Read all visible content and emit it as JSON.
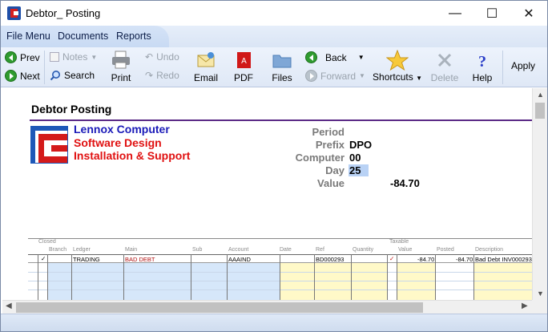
{
  "window": {
    "title": "Debtor_ Posting",
    "minimize": "—",
    "maximize": "☐",
    "close": "✕"
  },
  "menu": [
    "File Menu",
    "Documents",
    "Reports"
  ],
  "toolbar": {
    "prev": "Prev",
    "next": "Next",
    "notes": "Notes",
    "search": "Search",
    "print": "Print",
    "undo": "Undo",
    "redo": "Redo",
    "email": "Email",
    "pdf": "PDF",
    "files": "Files",
    "back": "Back",
    "forward": "Forward",
    "shortcuts": "Shortcuts",
    "delete": "Delete",
    "help": "Help",
    "apply": "Apply"
  },
  "form": {
    "heading": "Debtor Posting",
    "company": [
      "Lennox Computer",
      "Software Design",
      "Installation & Support"
    ],
    "fields": [
      {
        "label": "Period",
        "value": ""
      },
      {
        "label": "Prefix",
        "value": "DPO"
      },
      {
        "label": "Computer",
        "value": "00"
      },
      {
        "label": "Day",
        "value": "25"
      },
      {
        "label": "Value",
        "value": "-84.70"
      }
    ]
  },
  "grid": {
    "group_headers": {
      "closed": "Closed",
      "taxable": "Taxable"
    },
    "columns": [
      "Branch",
      "Ledger",
      "Main",
      "Sub",
      "Account",
      "Date",
      "Ref",
      "Quantity",
      "Value",
      "Posted",
      "Description"
    ],
    "rows": [
      {
        "closed": "✓",
        "branch": "",
        "ledger": "TRADING",
        "main": "BAD DEBT",
        "sub": "",
        "account": "AAAIND",
        "date": "",
        "ref": "BD000293",
        "quantity": "",
        "taxable": "✓",
        "value": "-84.70",
        "posted": "-84.70",
        "description": "Bad Debt INV000293"
      }
    ]
  }
}
